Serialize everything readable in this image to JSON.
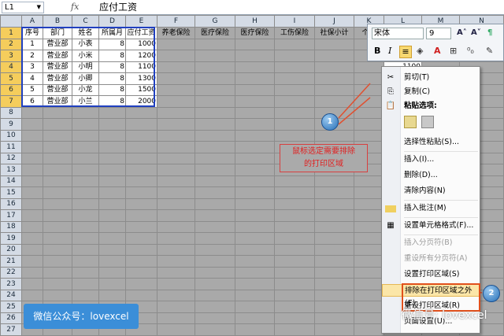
{
  "formula_bar": {
    "name_box": "L1",
    "fx": "fx",
    "value": "应付工资"
  },
  "columns": [
    "A",
    "B",
    "C",
    "D",
    "E",
    "F",
    "G",
    "H",
    "I",
    "J",
    "K",
    "L",
    "M",
    "N"
  ],
  "header_row": [
    "序号",
    "部门",
    "姓名",
    "所属月",
    "应付工资",
    "养老保险",
    "医疗保险",
    "医疗保险",
    "工伤保险",
    "社保小计",
    "个税",
    "应付"
  ],
  "rows": [
    [
      "1",
      "营业部",
      "小表",
      "8",
      "1000"
    ],
    [
      "2",
      "营业部",
      "小米",
      "8",
      "1200"
    ],
    [
      "3",
      "营业部",
      "小明",
      "8",
      "1100"
    ],
    [
      "4",
      "营业部",
      "小卿",
      "8",
      "1300"
    ],
    [
      "5",
      "营业部",
      "小龙",
      "8",
      "1500"
    ],
    [
      "6",
      "营业部",
      "小兰",
      "8",
      "2000"
    ]
  ],
  "row_numbers": [
    "1",
    "2",
    "3",
    "4",
    "5",
    "6",
    "7",
    "8",
    "9",
    "10",
    "11",
    "12",
    "13",
    "14",
    "15",
    "16",
    "17",
    "18",
    "19",
    "20",
    "21",
    "22",
    "23",
    "24",
    "25",
    "26",
    "27"
  ],
  "l_partial": "1100",
  "mini_toolbar": {
    "font": "宋体",
    "size": "9",
    "grow": "A˄",
    "shrink": "A˅",
    "bold": "B",
    "italic": "I"
  },
  "menu": {
    "cut": "剪切(T)",
    "copy": "复制(C)",
    "paste_options": "粘贴选项:",
    "paste_special": "选择性粘贴(S)...",
    "insert": "插入(I)...",
    "delete": "删除(D)...",
    "clear": "清除内容(N)",
    "insert_comment": "插入批注(M)",
    "format_cells": "设置单元格格式(F)...",
    "insert_page_break": "插入分页符(B)",
    "reset_page_breaks": "重设所有分页符(A)",
    "set_print_area": "设置打印区域(S)",
    "exclude_print_area": "排除在打印区域之外(E)",
    "reset_print_area": "重设打印区域(R)",
    "page_setup": "页面设置(U)..."
  },
  "callout": {
    "line1": "鼠标选定需要排除",
    "line2": "的打印区域"
  },
  "step1": "1",
  "step2": "2",
  "badge": "微信公众号：lovexcel",
  "watermark": "微信号: lovexcel",
  "colors": {
    "accent_blue": "#2040c0",
    "callout_red": "#e02020",
    "highlight": "#e0501c"
  }
}
